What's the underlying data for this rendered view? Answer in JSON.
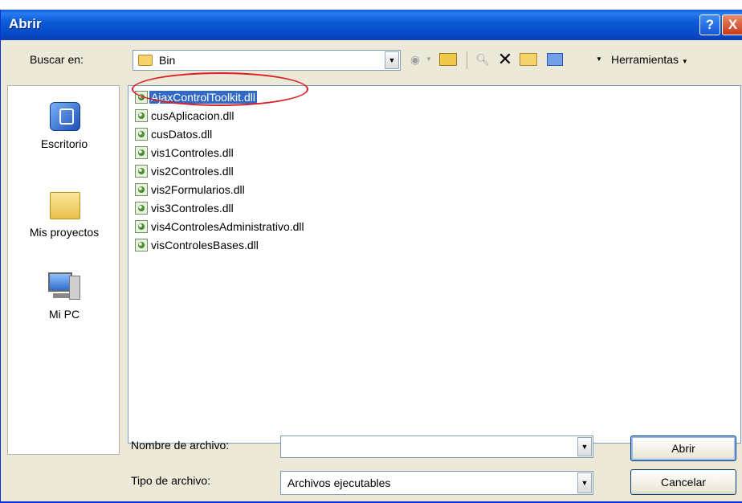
{
  "window": {
    "title": "Abrir",
    "help_label": "?",
    "close_label": "X"
  },
  "toolbar": {
    "look_in_label": "Buscar en:",
    "look_in_value": "Bin",
    "tools_label": "Herramientas"
  },
  "places": [
    {
      "label": "Escritorio",
      "icon": "desktop-icon"
    },
    {
      "label": "Mis proyectos",
      "icon": "folder-icon"
    },
    {
      "label": "Mi PC",
      "icon": "my-computer-icon"
    }
  ],
  "files": [
    "AjaxControlToolkit.dll",
    "cusAplicacion.dll",
    "cusDatos.dll",
    "vis1Controles.dll",
    "vis2Controles.dll",
    "vis2Formularios.dll",
    "vis3Controles.dll",
    "vis4ControlesAdministrativo.dll",
    "visControlesBases.dll"
  ],
  "selected_file_index": 0,
  "footer": {
    "filename_label": "Nombre de archivo:",
    "filename_value": "",
    "filetype_label": "Tipo de archivo:",
    "filetype_value": "Archivos ejecutables",
    "open_button": "Abrir",
    "cancel_button": "Cancelar"
  },
  "colors": {
    "titlebar": "#0b5bd7",
    "selection": "#316ac5",
    "annotation": "#d8202a"
  }
}
